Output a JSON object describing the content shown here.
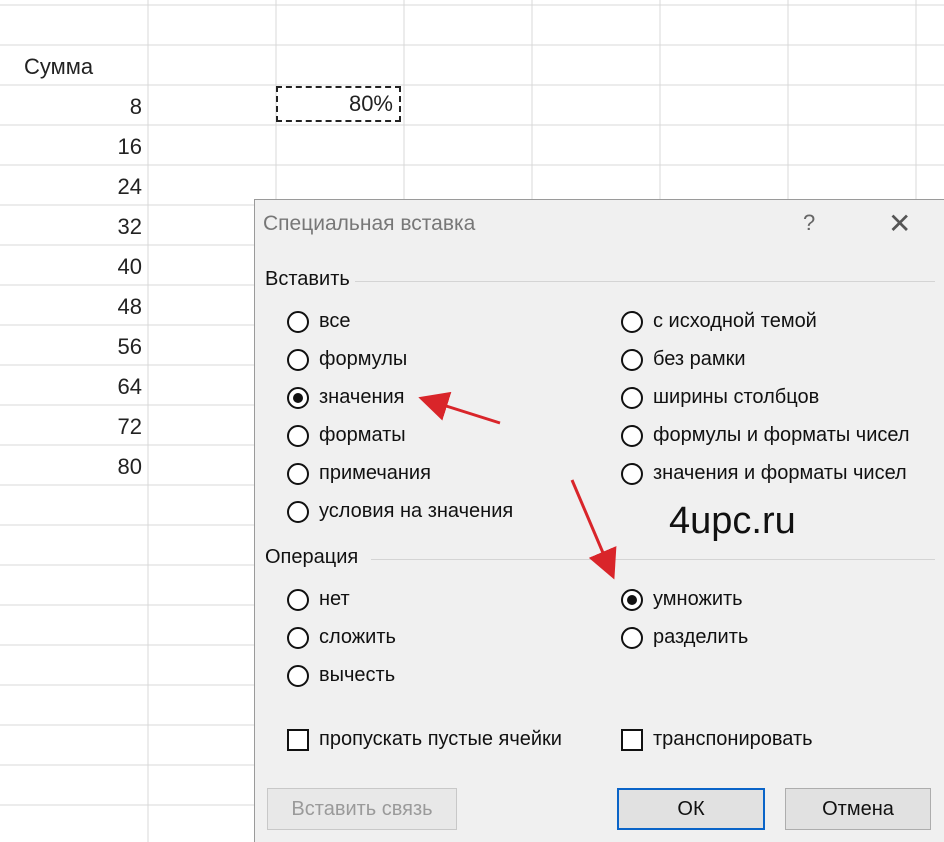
{
  "sheet": {
    "header": "Сумма",
    "values": [
      "8",
      "16",
      "24",
      "32",
      "40",
      "48",
      "56",
      "64",
      "72",
      "80"
    ],
    "copied_cell": "80%"
  },
  "dialog": {
    "title": "Специальная вставка",
    "help": "?",
    "close": "✕",
    "paste_group_label": "Вставить",
    "paste_options_left": [
      {
        "label": "все",
        "selected": false
      },
      {
        "label": "формулы",
        "selected": false
      },
      {
        "label": "значения",
        "selected": true
      },
      {
        "label": "форматы",
        "selected": false
      },
      {
        "label": "примечания",
        "selected": false
      },
      {
        "label": "условия на значения",
        "selected": false
      }
    ],
    "paste_options_right": [
      {
        "label": "с исходной темой",
        "selected": false
      },
      {
        "label": "без рамки",
        "selected": false
      },
      {
        "label": "ширины столбцов",
        "selected": false
      },
      {
        "label": "формулы и форматы чисел",
        "selected": false
      },
      {
        "label": "значения и форматы чисел",
        "selected": false
      }
    ],
    "operation_group_label": "Операция",
    "operation_options_left": [
      {
        "label": "нет",
        "selected": false
      },
      {
        "label": "сложить",
        "selected": false
      },
      {
        "label": "вычесть",
        "selected": false
      }
    ],
    "operation_options_right": [
      {
        "label": "умножить",
        "selected": true
      },
      {
        "label": "разделить",
        "selected": false
      }
    ],
    "skip_blanks": "пропускать пустые ячейки",
    "transpose": "транспонировать",
    "paste_link_button": "Вставить связь",
    "ok_button": "ОК",
    "cancel_button": "Отмена"
  },
  "watermark": "4upc.ru",
  "colors": {
    "arrow": "#d9252a",
    "default_button_border": "#0a64c8"
  }
}
